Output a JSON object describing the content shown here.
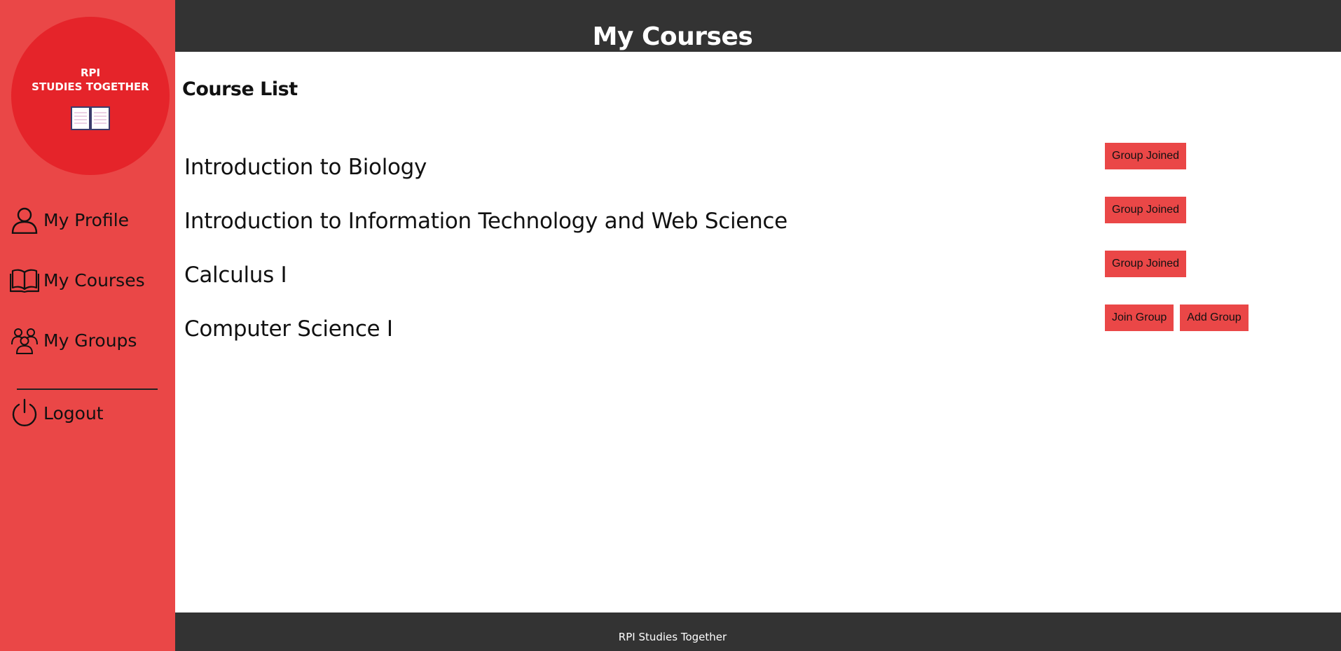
{
  "sidebar": {
    "logo": {
      "line1": "RPI",
      "line2": "STUDIES TOGETHER"
    },
    "nav": [
      {
        "label": "My Profile",
        "icon": "user-icon"
      },
      {
        "label": "My Courses",
        "icon": "book-icon"
      },
      {
        "label": "My Groups",
        "icon": "group-icon"
      }
    ],
    "logout": {
      "label": "Logout",
      "icon": "power-icon"
    }
  },
  "header": {
    "title": "My Courses"
  },
  "main": {
    "section_title": "Course List",
    "courses": [
      {
        "name": "Introduction to Biology",
        "actions": [
          "Group Joined"
        ]
      },
      {
        "name": "Introduction to Information Technology and Web Science",
        "actions": [
          "Group Joined"
        ]
      },
      {
        "name": "Calculus I",
        "actions": [
          "Group Joined"
        ]
      },
      {
        "name": "Computer Science I",
        "actions": [
          "Join Group",
          "Add Group"
        ]
      }
    ]
  },
  "footer": {
    "text": "RPI Studies Together"
  },
  "colors": {
    "sidebar": "#ea4747",
    "logo_circle": "#e5242a",
    "header": "#333333",
    "button": "#ea4747"
  }
}
